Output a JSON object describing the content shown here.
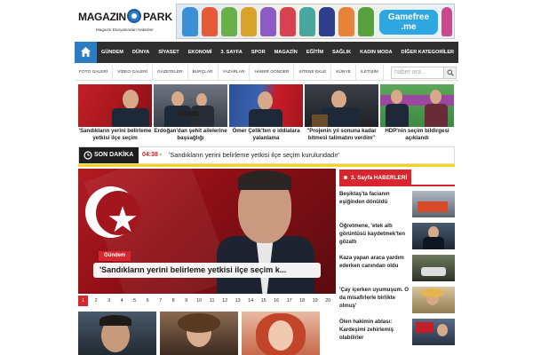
{
  "logo": {
    "part1": "MAGAZIN",
    "part2": "PARK",
    "tagline": "Magazin Dünyasından Haberler"
  },
  "banner": {
    "text_line1": "Gamefree",
    "text_line2": ".me"
  },
  "nav": {
    "items": [
      "GÜNDEM",
      "DÜNYA",
      "SİYASET",
      "EKONOMİ",
      "3. SAYFA",
      "SPOR",
      "MAGAZİN",
      "EĞİTİM",
      "SAĞLIK",
      "KADIN MODA",
      "DİĞER KATEGORİLER"
    ]
  },
  "subnav": {
    "items": [
      "FOTO GALERİ",
      "VİDEO GALERİ",
      "GAZETELER",
      "BURÇLAR",
      "YAZARLAR",
      "HABER GÖNDER",
      "SİTENE EKLE",
      "KÜNYE",
      "İLETİŞİM"
    ],
    "search_placeholder": "haber ara..."
  },
  "thumbs": [
    {
      "caption": "'Sandıkların yerini belirleme yetkisi ilçe seçim"
    },
    {
      "caption": "Erdoğan'dan şehit ailelerine başsağlığı"
    },
    {
      "caption": "Ömer Çelik'ten o iddialara yalanlama"
    },
    {
      "caption": "\"Projenin yıl sonuna kadar bitmesi talimatını verdim\""
    },
    {
      "caption": "HDP'nin seçim bildirgesi açıklandı"
    }
  ],
  "breaking": {
    "label": "SON DAKİKA",
    "time": "04:38 -",
    "text": "'Sandıkların yerini belirleme yetkisi ilçe seçim kurulundadır'"
  },
  "slider": {
    "category": "Gündem",
    "title": "'Sandıkların yerini belirleme yetkisi ilçe seçim k..."
  },
  "pager": [
    "1",
    "2",
    "3",
    "4",
    "5",
    "6",
    "7",
    "8",
    "9",
    "10",
    "11",
    "12",
    "13",
    "14",
    "15",
    "16",
    "17",
    "18",
    "19",
    "20"
  ],
  "side": {
    "title": "3. Sayfa HABERLERİ",
    "items": [
      {
        "title": "Beşiktaş'ta facianın eşiğinden dönüldü"
      },
      {
        "title": "Öğretmene, 'etek altı görüntüsü kaydetmek'ten gözaltı"
      },
      {
        "title": "Kaza yapan araca yardım ederken canından oldu"
      },
      {
        "title": "'Çay içerken uyumuşum. O da misafirlerle birlikte olmuş'"
      },
      {
        "title": "Ölen hakimin ablası: Kardeşimi zehirlemiş olabilirler"
      }
    ]
  },
  "colors": {
    "accent": "#d7262d",
    "nav_bg": "#2f2f2f",
    "home_blue": "#2a7dc3",
    "breaking_yellow": "#f7d417"
  }
}
